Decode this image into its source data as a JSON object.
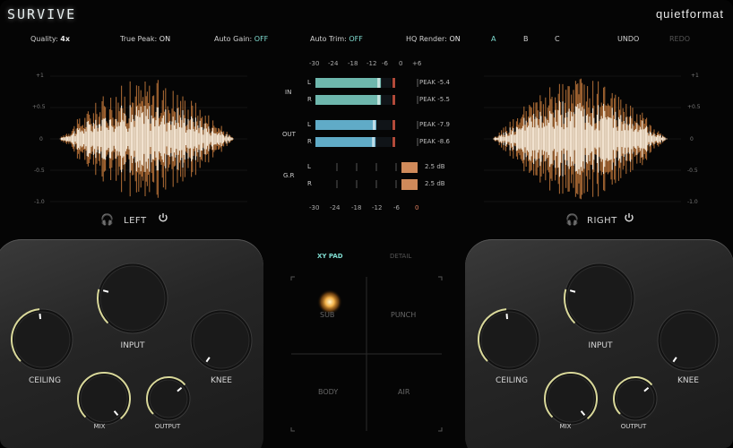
{
  "app": {
    "title": "SURVIVE",
    "brand": "quietformat"
  },
  "toolbar": {
    "quality_label": "Quality:",
    "quality_value": "4x",
    "truepeak_label": "True Peak:",
    "truepeak_value": "ON",
    "autogain_label": "Auto Gain:",
    "autogain_value": "OFF",
    "autotrim_label": "Auto Trim:",
    "autotrim_value": "OFF",
    "hq_label": "HQ Render:",
    "hq_value": "ON",
    "presets": [
      "A",
      "B",
      "C"
    ],
    "undo": "UNDO",
    "redo": "REDO"
  },
  "scope": {
    "scale": [
      "+1",
      "+0.5",
      "0",
      "-0.5",
      "-1.0"
    ]
  },
  "left": {
    "label": "LEFT"
  },
  "right": {
    "label": "RIGHT"
  },
  "meters": {
    "ticks": [
      "-30",
      "-24",
      "-18",
      "-12",
      "-6",
      "0",
      "+6"
    ],
    "bottom_ticks": [
      "-30",
      "-24",
      "-18",
      "-12",
      "-6",
      "0"
    ],
    "in_label": "IN",
    "out_label": "OUT",
    "gr_label": "G.R",
    "in_L": {
      "ch": "L",
      "peak": "PEAK -5.4",
      "level": 0.86
    },
    "in_R": {
      "ch": "R",
      "peak": "PEAK -5.5",
      "level": 0.86
    },
    "out_L": {
      "ch": "L",
      "peak": "PEAK -7.9",
      "level": 0.8
    },
    "out_R": {
      "ch": "R",
      "peak": "PEAK -8.6",
      "level": 0.79
    },
    "gr_L": {
      "ch": "L",
      "value": "2.5 dB"
    },
    "gr_R": {
      "ch": "R",
      "value": "2.5 dB"
    }
  },
  "controls": {
    "input": "INPUT",
    "ceiling": "CEILING",
    "knee": "KNEE",
    "mix": "MIX",
    "output": "OUTPUT"
  },
  "tabs": {
    "xy": "XY PAD",
    "detail": "DETAIL"
  },
  "xy": {
    "sub": "SUB",
    "punch": "PUNCH",
    "body": "BODY",
    "air": "AIR"
  },
  "colors": {
    "accent": "#7fdcd0",
    "meter": "#7fd3c8",
    "meter_out": "#6fc6e6",
    "gr": "#d08a5a",
    "knob_ring": "#d9d89a"
  }
}
